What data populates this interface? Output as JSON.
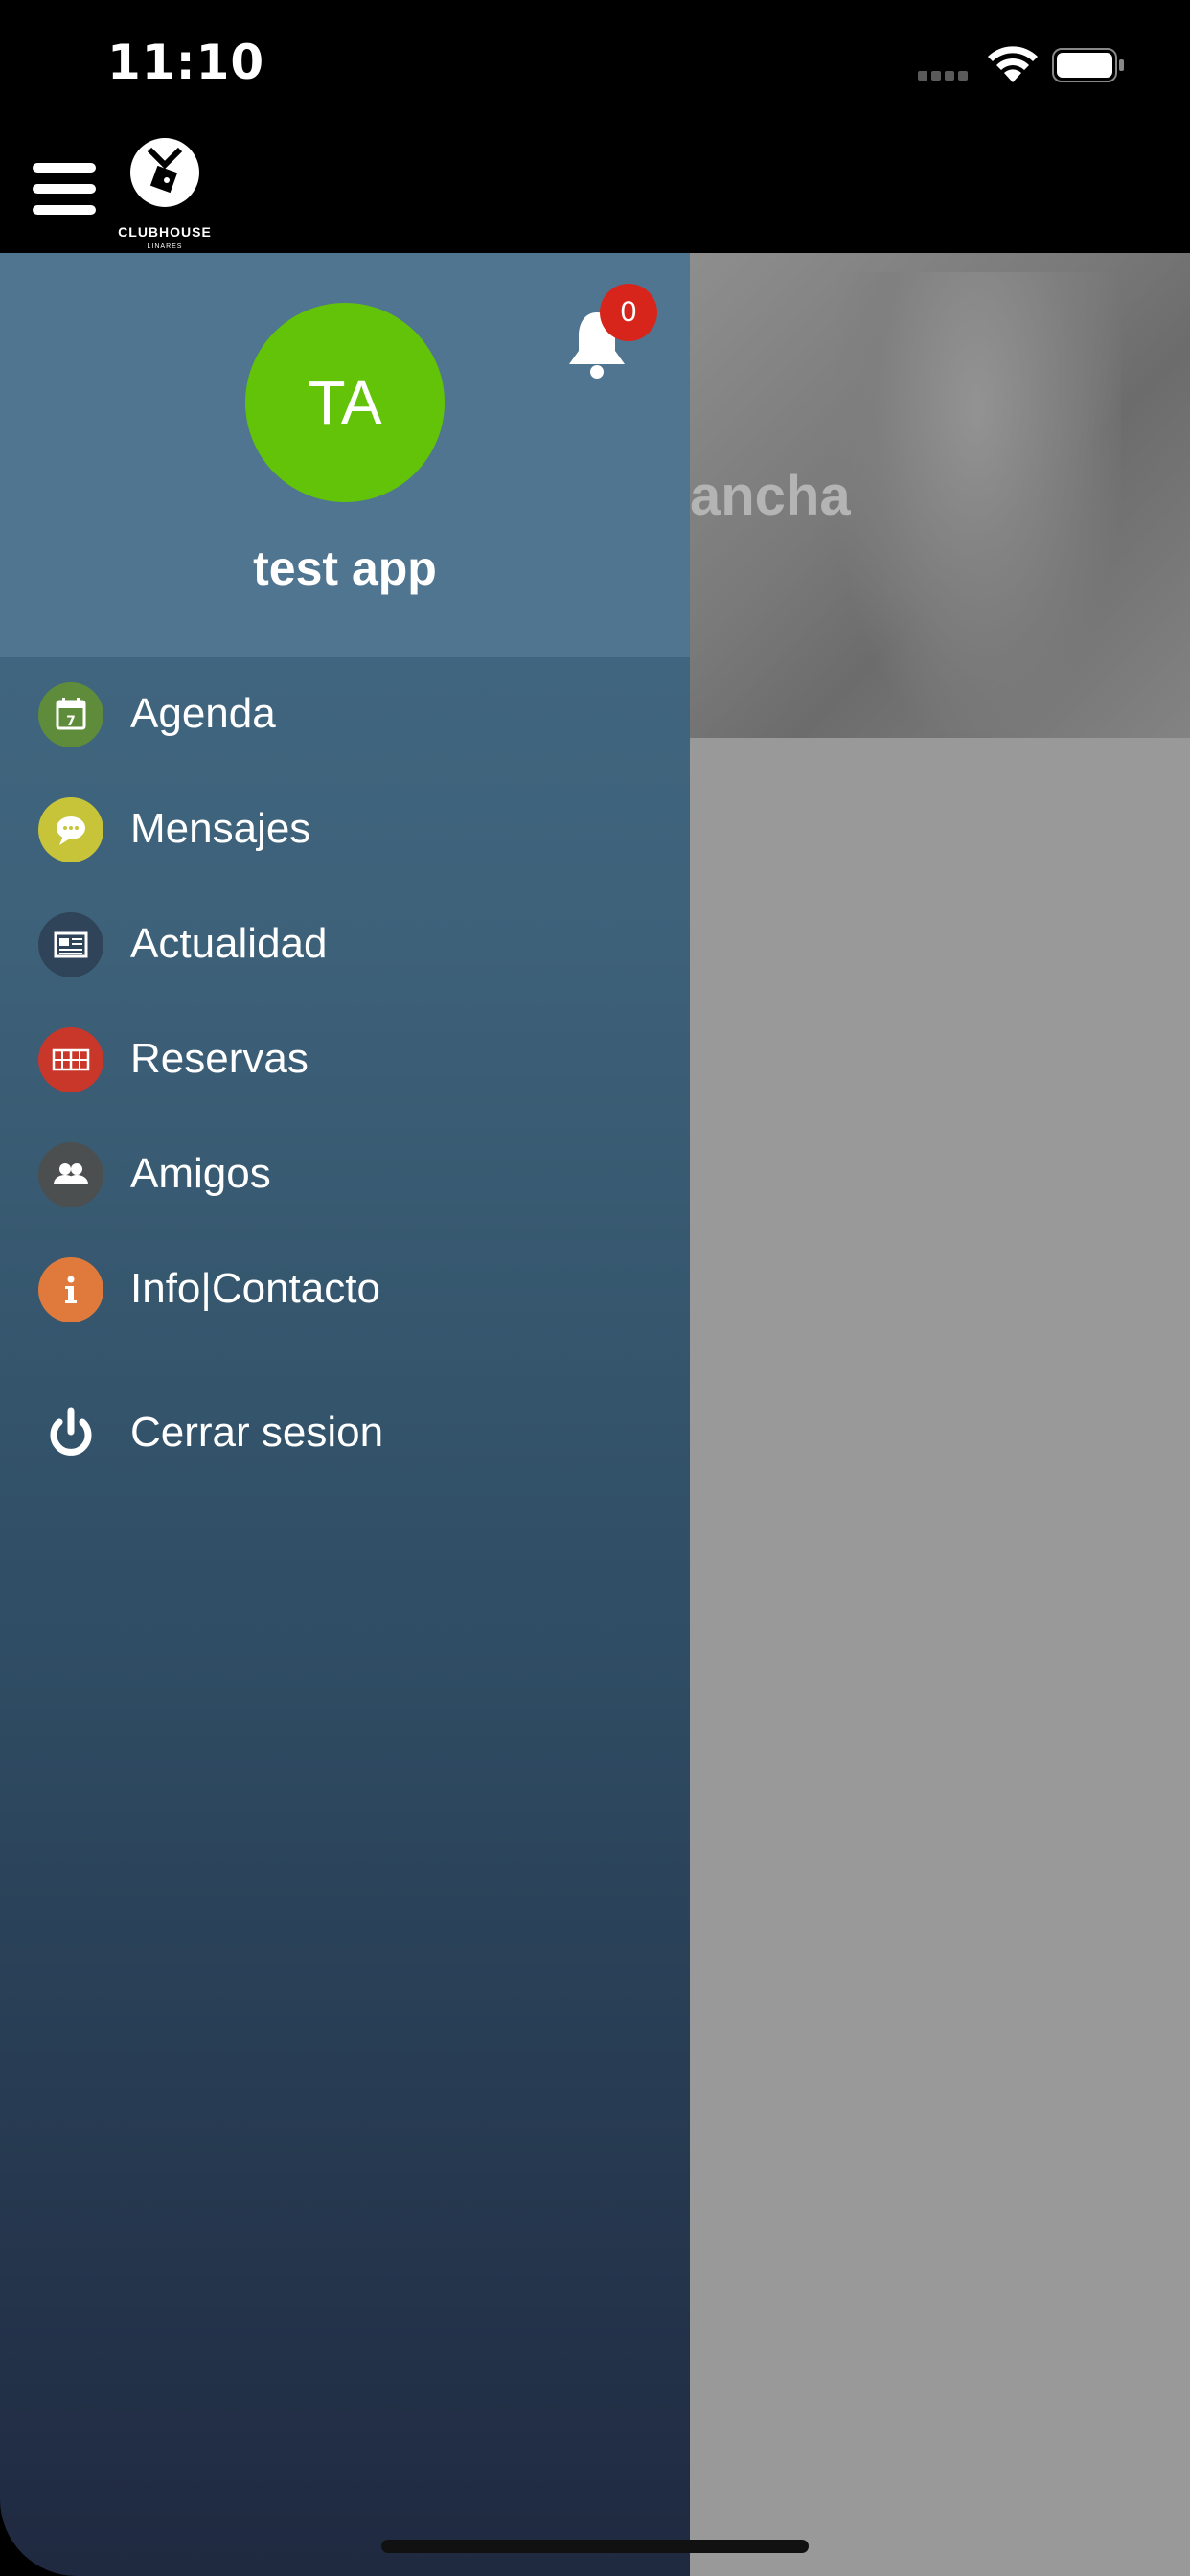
{
  "status_bar": {
    "time": "11:10"
  },
  "top_bar": {
    "logo_text": "CLUBHOUSE",
    "logo_subtext": "LINARES"
  },
  "background_page": {
    "banner_text": "ancha"
  },
  "drawer": {
    "avatar_initials": "TA",
    "username": "test app",
    "notification_count": "0",
    "menu": [
      {
        "label": "Agenda",
        "icon": "calendar-icon",
        "color": "#5e8c3a"
      },
      {
        "label": "Mensajes",
        "icon": "message-icon",
        "color": "#c7c43a"
      },
      {
        "label": "Actualidad",
        "icon": "news-icon",
        "color": "#2f4458"
      },
      {
        "label": "Reservas",
        "icon": "court-icon",
        "color": "#c8372a"
      },
      {
        "label": "Amigos",
        "icon": "friends-icon",
        "color": "#4c4f50"
      },
      {
        "label": "Info|Contacto",
        "icon": "info-icon",
        "color": "#e07a3c"
      }
    ],
    "logout_label": "Cerrar sesion"
  },
  "colors": {
    "avatar": "#62c308",
    "badge": "#d8251b",
    "profile_header": "#4f7590",
    "drawer_bottom": "#1f2940"
  }
}
